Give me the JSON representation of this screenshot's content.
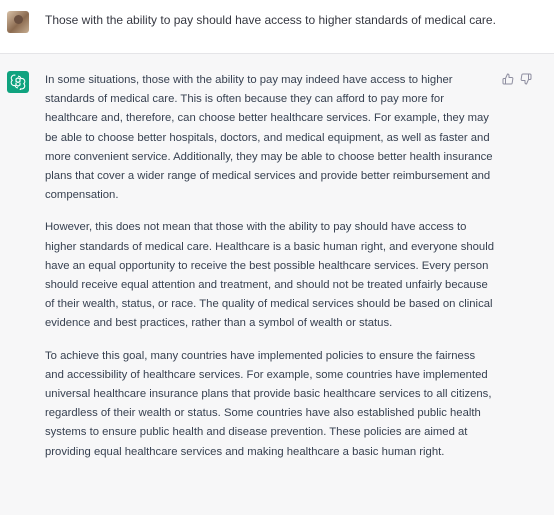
{
  "user_message": {
    "text": "Those with the ability to pay should have access to higher standards of medical care."
  },
  "assistant_message": {
    "paragraphs": [
      "In some situations, those with the ability to pay may indeed have access to higher standards of medical care. This is often because they can afford to pay more for healthcare and, therefore, can choose better healthcare services. For example, they may be able to choose better hospitals, doctors, and medical equipment, as well as faster and more convenient service. Additionally, they may be able to choose better health insurance plans that cover a wider range of medical services and provide better reimbursement and compensation.",
      "However, this does not mean that those with the ability to pay should have access to higher standards of medical care. Healthcare is a basic human right, and everyone should have an equal opportunity to receive the best possible healthcare services. Every person should receive equal attention and treatment, and should not be treated unfairly because of their wealth, status, or race. The quality of medical services should be based on clinical evidence and best practices, rather than a symbol of wealth or status.",
      "To achieve this goal, many countries have implemented policies to ensure the fairness and accessibility of healthcare services. For example, some countries have implemented universal healthcare insurance plans that provide basic healthcare services to all citizens, regardless of their wealth or status. Some countries have also established public health systems to ensure public health and disease prevention. These policies are aimed at providing equal healthcare services and making healthcare a basic human right."
    ]
  },
  "icons": {
    "user_avatar": "user-photo-avatar",
    "assistant_avatar": "openai-logo-icon",
    "thumbs_up": "thumbs-up-icon",
    "thumbs_down": "thumbs-down-icon"
  },
  "colors": {
    "assistant_bg": "#f7f7f8",
    "brand": "#10a37f",
    "text": "#374151"
  }
}
